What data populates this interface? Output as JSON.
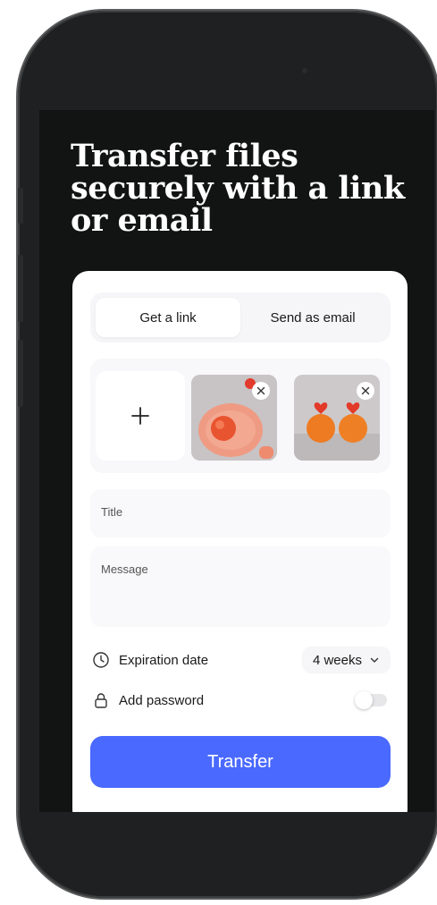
{
  "screen": {
    "headline": "Transfer files securely with a link or email",
    "tabs": [
      {
        "label": "Get a link",
        "active": true
      },
      {
        "label": "Send as email",
        "active": false
      }
    ],
    "uploads": {
      "add_icon": "plus-icon",
      "thumbnails": [
        {
          "name": "orange-on-plate-photo"
        },
        {
          "name": "oranges-with-hearts-photo"
        }
      ],
      "remove_icon": "close-icon"
    },
    "title_placeholder": "Title",
    "message_placeholder": "Message",
    "expiration": {
      "icon": "clock-icon",
      "label": "Expiration date",
      "value": "4 weeks",
      "chevron": "chevron-down-icon"
    },
    "password": {
      "icon": "lock-icon",
      "label": "Add password",
      "enabled": false
    },
    "transfer_label": "Transfer"
  },
  "colors": {
    "screen_bg": "#121313",
    "primary": "#4a69ff",
    "card": "#ffffff"
  }
}
